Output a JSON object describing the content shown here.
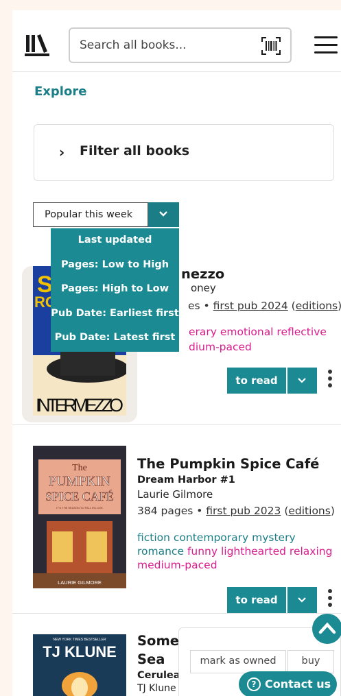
{
  "header": {
    "search_placeholder": "Search all books..."
  },
  "explore_label": "Explore",
  "filter": {
    "label": "Filter all books"
  },
  "sort": {
    "selected": "Popular this week",
    "options": [
      "Last updated",
      "Pages: Low to High",
      "Pages: High to Low",
      "Pub Date: Earliest first",
      "Pub Date: Latest first"
    ]
  },
  "books": [
    {
      "title_visible": "nezzo",
      "author_visible": "oney",
      "meta_visible": "es • ",
      "first_pub": "first pub 2024",
      "editions": "editions",
      "tags_line1_pink": "erary emotional reflective",
      "tags_line2_pink": "dium-paced",
      "cover_text": "INTERMEZZO",
      "to_read_label": "to read"
    },
    {
      "title": "The Pumpkin Spice Café",
      "series": "Dream Harbor #1",
      "author": "Laurie Gilmore",
      "pages": "384 pages • ",
      "first_pub": "first pub 2023",
      "editions": "editions",
      "tags_teal": "fiction contemporary mystery romance",
      "tags_pink": "funny lighthearted relaxing medium-paced",
      "cover_line1": "The",
      "cover_line2": "PUMPKIN",
      "cover_line3": "SPICE CAFÉ",
      "cover_tagline": "IT'S THE SEASON TO FALL IN LOVE",
      "cover_author": "LAURIE GILMORE",
      "to_read_label": "to read"
    },
    {
      "title_line1": "Some",
      "title_line2": "Sea",
      "series_visible": "Cerulea",
      "author_visible": "TJ Klune",
      "cover_author": "TJ KLUNE",
      "cover_banner": "NEW YORK TIMES BESTSELLER"
    }
  ],
  "popover": {
    "owned_label": "mark as owned",
    "buy_label": "buy"
  },
  "contact": {
    "label": "Contact us",
    "icon": "?"
  },
  "colors": {
    "teal": "#1b8a93",
    "pink": "#d81b8c",
    "background": "#fdf5ee"
  }
}
